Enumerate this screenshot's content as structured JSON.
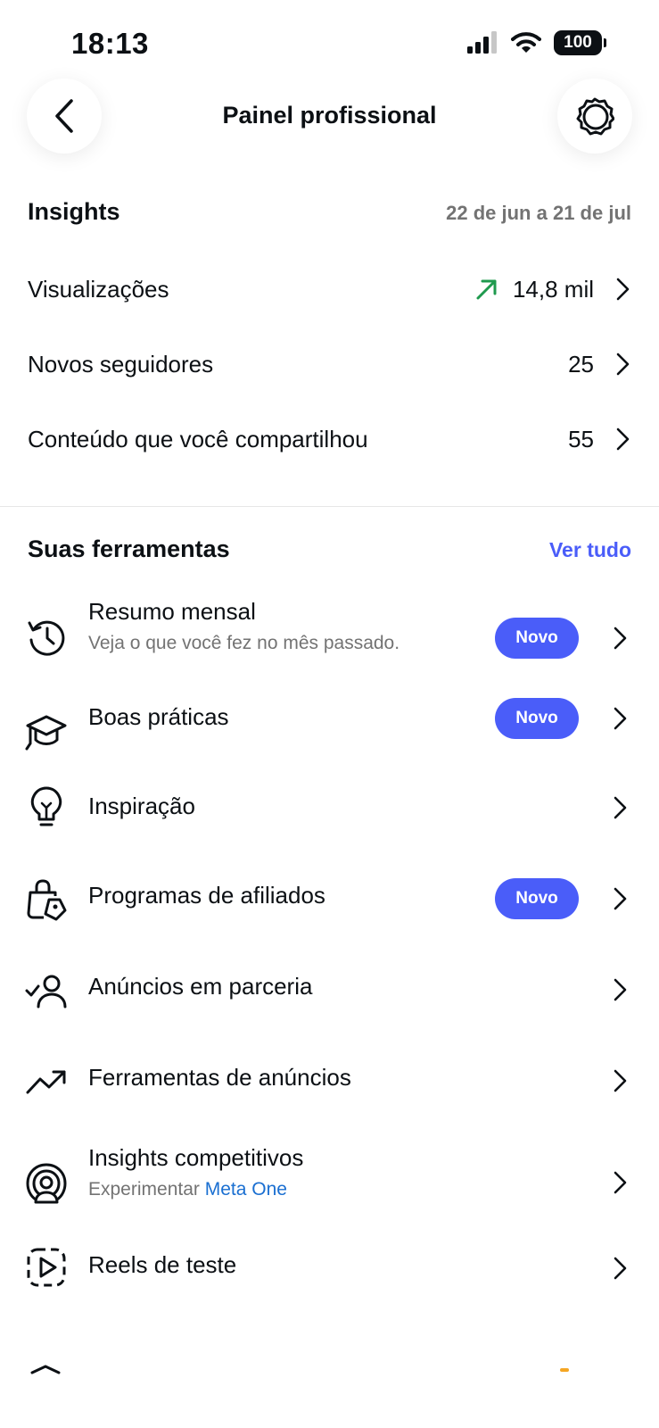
{
  "status_bar": {
    "time": "18:13",
    "battery": "100"
  },
  "header": {
    "title": "Painel profissional",
    "back_icon": "chevron-left-icon",
    "settings_icon": "gear-icon"
  },
  "insights": {
    "title": "Insights",
    "date_range": "22 de jun a 21 de jul",
    "trend_color": "#1f9a4e",
    "rows": [
      {
        "label": "Visualizações",
        "value": "14,8 mil",
        "trend": "up"
      },
      {
        "label": "Novos seguidores",
        "value": "25"
      },
      {
        "label": "Conteúdo que você compartilhou",
        "value": "55"
      }
    ]
  },
  "tools": {
    "title": "Suas ferramentas",
    "see_all": "Ver tudo",
    "accent_color": "#4a5df9",
    "items": [
      {
        "label": "Resumo mensal",
        "subtitle": "Veja o que você fez no mês passado.",
        "badge": "Novo",
        "icon": "history-icon"
      },
      {
        "label": "Boas práticas",
        "badge": "Novo",
        "icon": "graduation-cap-icon"
      },
      {
        "label": "Inspiração",
        "icon": "lightbulb-icon"
      },
      {
        "label": "Programas de afiliados",
        "badge": "Novo",
        "icon": "shopping-bag-tag-icon"
      },
      {
        "label": "Anúncios em parceria",
        "icon": "person-check-icon"
      },
      {
        "label": "Ferramentas de anúncios",
        "icon": "trending-up-icon"
      },
      {
        "label": "Insights competitivos",
        "subtitle_prefix": "Experimentar",
        "subtitle_link": "Meta One",
        "icon": "radar-icon"
      },
      {
        "label": "Reels de teste",
        "icon": "dashed-play-icon"
      }
    ]
  }
}
